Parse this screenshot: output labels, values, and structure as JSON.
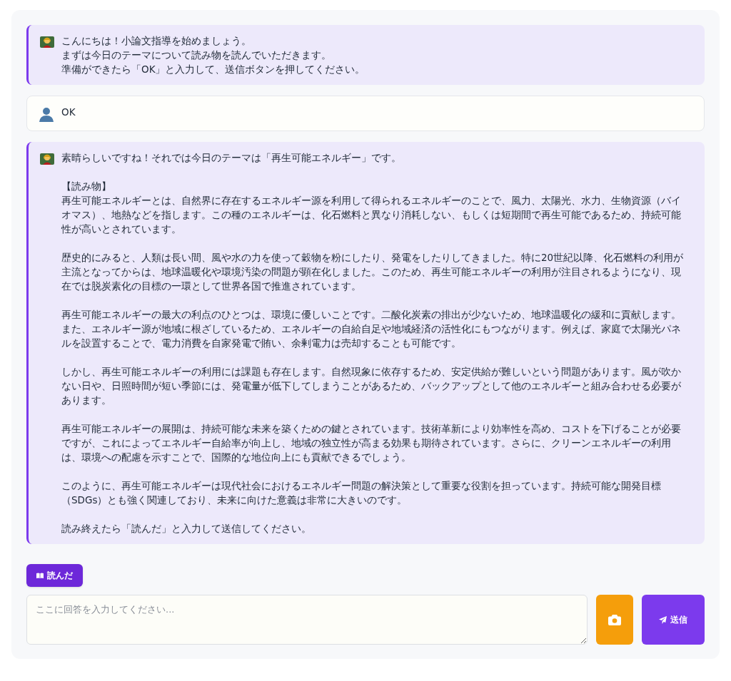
{
  "messages": [
    {
      "kind": "bot",
      "paragraphs": [
        [
          "こんにちは！小論文指導を始めましょう。",
          "まずは今日のテーマについて読み物を読んでいただきます。",
          "準備ができたら「OK」と入力して、送信ボタンを押してください。"
        ]
      ]
    },
    {
      "kind": "user",
      "paragraphs": [
        [
          "OK"
        ]
      ]
    },
    {
      "kind": "bot",
      "paragraphs": [
        [
          "素晴らしいですね！それでは今日のテーマは「再生可能エネルギー」です。"
        ],
        [
          "【読み物】",
          "再生可能エネルギーとは、自然界に存在するエネルギー源を利用して得られるエネルギーのことで、風力、太陽光、水力、生物資源（バイオマス）、地熱などを指します。この種のエネルギーは、化石燃料と異なり消耗しない、もしくは短期間で再生可能であるため、持続可能性が高いとされています。"
        ],
        [
          "歴史的にみると、人類は長い間、風や水の力を使って穀物を粉にしたり、発電をしたりしてきました。特に20世紀以降、化石燃料の利用が主流となってからは、地球温暖化や環境汚染の問題が顕在化しました。このため、再生可能エネルギーの利用が注目されるようになり、現在では脱炭素化の目標の一環として世界各国で推進されています。"
        ],
        [
          "再生可能エネルギーの最大の利点のひとつは、環境に優しいことです。二酸化炭素の排出が少ないため、地球温暖化の緩和に貢献します。また、エネルギー源が地域に根ざしているため、エネルギーの自給自足や地域経済の活性化にもつながります。例えば、家庭で太陽光パネルを設置することで、電力消費を自家発電で賄い、余剰電力は売却することも可能です。"
        ],
        [
          "しかし、再生可能エネルギーの利用には課題も存在します。自然現象に依存するため、安定供給が難しいという問題があります。風が吹かない日や、日照時間が短い季節には、発電量が低下してしまうことがあるため、バックアップとして他のエネルギーと組み合わせる必要があります。"
        ],
        [
          "再生可能エネルギーの展開は、持続可能な未来を築くための鍵とされています。技術革新により効率性を高め、コストを下げることが必要ですが、これによってエネルギー自給率が向上し、地域の独立性が高まる効果も期待されています。さらに、クリーンエネルギーの利用は、環境への配慮を示すことで、国際的な地位向上にも貢献できるでしょう。"
        ],
        [
          "このように、再生可能エネルギーは現代社会におけるエネルギー問題の解決策として重要な役割を担っています。持続可能な開発目標",
          "（SDGs）とも強く関連しており、未来に向けた意義は非常に大きいのです。"
        ],
        [
          "読み終えたら「読んだ」と入力して送信してください。"
        ]
      ]
    }
  ],
  "quick_reply": "読んだ",
  "input": {
    "placeholder": "ここに回答を入力してください..."
  },
  "send_button": "送信"
}
